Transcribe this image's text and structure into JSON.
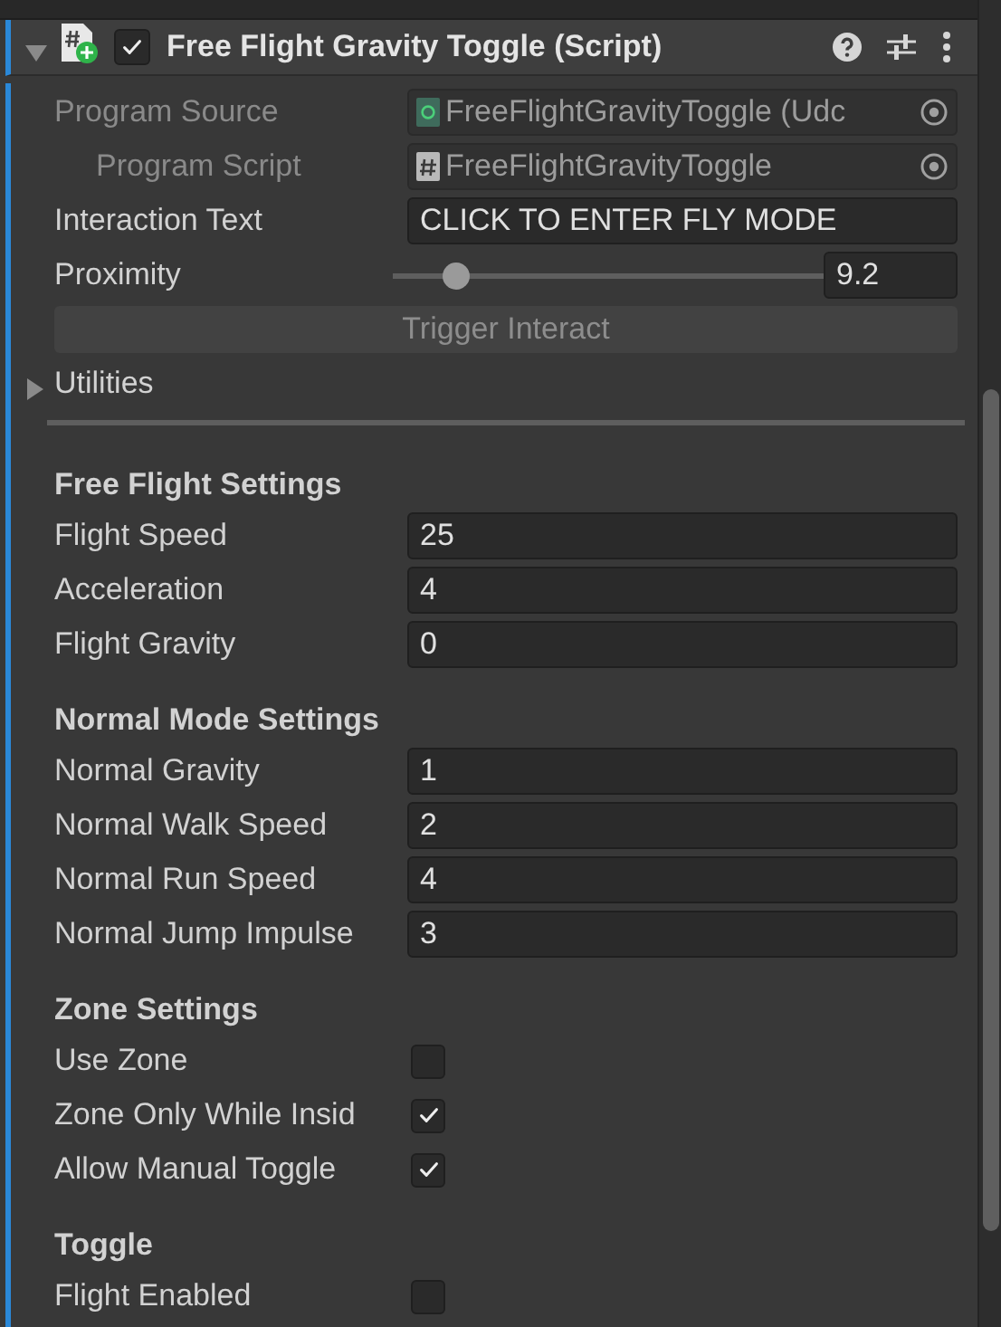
{
  "component": {
    "title": "Free Flight Gravity Toggle (Script)",
    "expanded": true,
    "enabled": true
  },
  "fields": [
    {
      "kind": "object",
      "label": "Program Source",
      "value": "FreeFlightGravityToggle (Udc",
      "disabled": true,
      "children": [
        {
          "kind": "object",
          "label": "Program Script",
          "value": "FreeFlightGravityToggle",
          "disabled": true
        }
      ]
    },
    {
      "kind": "text",
      "label": "Interaction Text",
      "value": "CLICK TO ENTER FLY MODE",
      "disabled": false
    },
    {
      "kind": "slider",
      "label": "Proximity",
      "level": 0.12,
      "value": "9.2",
      "disabled": false
    },
    {
      "kind": "button",
      "label": "Trigger Interact",
      "disabled": true
    }
  ],
  "utilities": {
    "label": "Utilities",
    "expanded": false
  },
  "sections": [
    {
      "title": "Free Flight Settings",
      "fields": [
        {
          "kind": "number",
          "label": "Flight Speed",
          "value": "25"
        },
        {
          "kind": "number",
          "label": "Acceleration",
          "value": "4"
        },
        {
          "kind": "number",
          "label": "Flight Gravity",
          "value": "0"
        }
      ]
    },
    {
      "title": "Normal Mode Settings",
      "fields": [
        {
          "kind": "number",
          "label": "Normal Gravity",
          "value": "1"
        },
        {
          "kind": "number",
          "label": "Normal Walk Speed",
          "value": "2"
        },
        {
          "kind": "number",
          "label": "Normal Run Speed",
          "value": "4"
        },
        {
          "kind": "number",
          "label": "Normal Jump Impulse",
          "value": "3"
        }
      ]
    },
    {
      "title": "Zone Settings",
      "fields": [
        {
          "kind": "checkbox",
          "label": "Use Zone",
          "checked": false
        },
        {
          "kind": "checkbox",
          "label": "Zone Only While Insid",
          "checked": true
        },
        {
          "kind": "checkbox",
          "label": "Allow Manual Toggle",
          "checked": true
        }
      ]
    },
    {
      "title": "Toggle",
      "fields": [
        {
          "kind": "checkbox",
          "label": "Flight Enabled",
          "checked": false
        }
      ]
    }
  ]
}
